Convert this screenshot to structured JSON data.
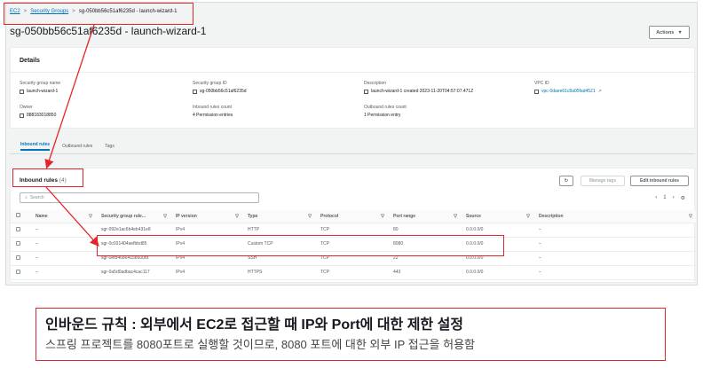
{
  "breadcrumb": {
    "ec2": "EC2",
    "security_groups": "Security Groups",
    "current": "sg-050bb56c51af6235d - launch-wizard-1"
  },
  "page_title": "sg-050bb56c51af6235d - launch-wizard-1",
  "actions_label": "Actions",
  "details": {
    "title": "Details",
    "name_label": "Security group name",
    "name_value": "launch-wizard-1",
    "id_label": "Security group ID",
    "id_value": "sg-050bb56c51af6235d",
    "desc_label": "Description",
    "desc_value": "launch-wizard-1 created 2023-11-20T04:57:07.471Z",
    "vpc_label": "VPC ID",
    "vpc_value": "vpc-0daee61c8a05fad4521",
    "owner_label": "Owner",
    "owner_value": "888183018850",
    "inbound_count_label": "Inbound rules count",
    "inbound_count_value": "4 Permission entries",
    "outbound_count_label": "Outbound rules count",
    "outbound_count_value": "1 Permission entry"
  },
  "tabs": [
    "Inbound rules",
    "Outbound rules",
    "Tags"
  ],
  "inbound": {
    "title": "Inbound rules",
    "count": "(4)",
    "manage_tags": "Manage tags",
    "edit_rules": "Edit inbound rules",
    "search_placeholder": "Search",
    "page": "1",
    "columns": [
      "Name",
      "Security group rule...",
      "IP version",
      "Type",
      "Protocol",
      "Port range",
      "Source",
      "Description"
    ],
    "rows": [
      [
        "–",
        "sgr-092e1ac6b4eb431e8",
        "IPv4",
        "HTTP",
        "TCP",
        "80",
        "0.0.0.0/0",
        "–"
      ],
      [
        "–",
        "sgr-0c031404aefbbd85",
        "IPv4",
        "Custom TCP",
        "TCP",
        "8080",
        "0.0.0.0/0",
        "–"
      ],
      [
        "–",
        "sgr-0ef846864158600fd",
        "IPv4",
        "SSH",
        "TCP",
        "22",
        "0.0.0.0/0",
        "–"
      ],
      [
        "–",
        "sgr-0a5d0adbac4cac117",
        "IPv4",
        "HTTPS",
        "TCP",
        "443",
        "0.0.0.0/0",
        "–"
      ]
    ]
  },
  "annotation": {
    "line1": "인바운드 규칙 : 외부에서 EC2로 접근할 때 IP와 Port에 대한 제한 설정",
    "line2": "스프링 프로젝트를 8080포트로 실행할 것이므로, 8080 포트에 대한 외부 IP 접근을 허용함"
  },
  "colors": {
    "highlight": "#e3262b",
    "link": "#0073bb"
  }
}
